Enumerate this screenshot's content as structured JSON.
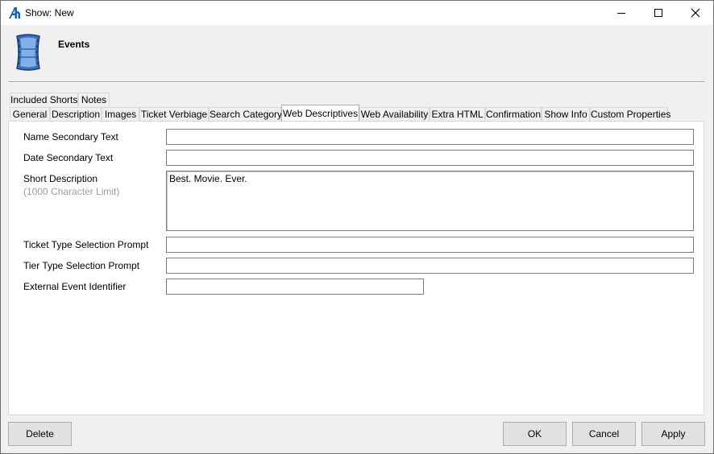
{
  "window": {
    "title": "Show: New",
    "icon": "app-logo-icon",
    "controls": [
      "minimize-icon",
      "maximize-icon",
      "close-icon"
    ]
  },
  "header": {
    "title": "Events",
    "icon": "film-strip-icon"
  },
  "tabs_row1": [
    {
      "label": "Included Shorts"
    },
    {
      "label": "Notes"
    }
  ],
  "tabs_row2": [
    {
      "label": "General"
    },
    {
      "label": "Description"
    },
    {
      "label": "Images"
    },
    {
      "label": "Ticket Verbiage"
    },
    {
      "label": "Search Category"
    },
    {
      "label": "Web Descriptives",
      "active": true
    },
    {
      "label": "Web Availability"
    },
    {
      "label": "Extra HTML"
    },
    {
      "label": "Confirmation"
    },
    {
      "label": "Show Info"
    },
    {
      "label": "Custom Properties"
    }
  ],
  "form": {
    "name_secondary": {
      "label": "Name Secondary Text",
      "value": ""
    },
    "date_secondary": {
      "label": "Date Secondary Text",
      "value": ""
    },
    "short_description": {
      "label": "Short Description",
      "hint": "(1000 Character Limit)",
      "value": "Best. Movie. Ever."
    },
    "ticket_type_prompt": {
      "label": "Ticket Type Selection Prompt",
      "value": ""
    },
    "tier_type_prompt": {
      "label": "Tier Type Selection Prompt",
      "value": ""
    },
    "external_event_id": {
      "label": "External Event Identifier",
      "value": ""
    }
  },
  "buttons": {
    "delete": "Delete",
    "ok": "OK",
    "cancel": "Cancel",
    "apply": "Apply"
  }
}
